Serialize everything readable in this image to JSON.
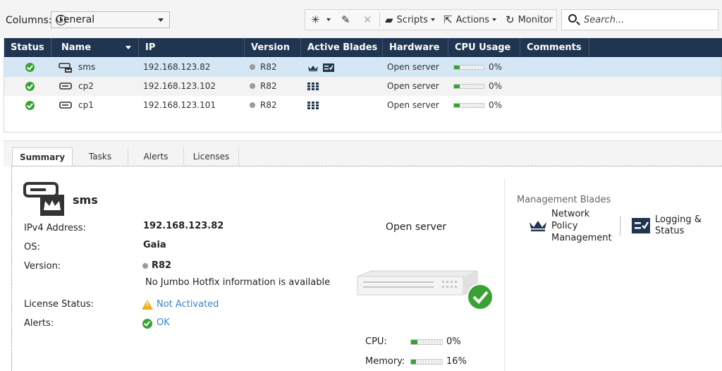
{
  "toolbar": {
    "columns_label": "Columns:",
    "columns_value": "General",
    "scripts_label": "Scripts",
    "actions_label": "Actions",
    "monitor_label": "Monitor",
    "search_placeholder": "Search..."
  },
  "grid": {
    "headers": {
      "status": "Status",
      "name": "Name",
      "ip": "IP",
      "version": "Version",
      "active_blades": "Active Blades",
      "hardware": "Hardware",
      "cpu_usage": "CPU Usage",
      "comments": "Comments"
    },
    "rows": [
      {
        "name": "sms",
        "ip": "192.168.123.82",
        "version": "R82",
        "hardware": "Open server",
        "cpu": "0%",
        "cpu_fraction": 0.2,
        "selected": true
      },
      {
        "name": "cp2",
        "ip": "192.168.123.102",
        "version": "R82",
        "hardware": "Open server",
        "cpu": "0%",
        "cpu_fraction": 0.2,
        "selected": false
      },
      {
        "name": "cp1",
        "ip": "192.168.123.101",
        "version": "R82",
        "hardware": "Open server",
        "cpu": "0%",
        "cpu_fraction": 0.2,
        "selected": false
      }
    ]
  },
  "tabs": [
    {
      "label": "Summary",
      "active": true
    },
    {
      "label": "Tasks",
      "active": false
    },
    {
      "label": "Alerts",
      "active": false
    },
    {
      "label": "Licenses",
      "active": false
    }
  ],
  "summary": {
    "name": "sms",
    "ipv4_label": "IPv4 Address:",
    "ipv4_value": "192.168.123.82",
    "os_label": "OS:",
    "os_value": "Gaia",
    "version_label": "Version:",
    "version_value": "R82",
    "hotfix_text": "No Jumbo Hotfix information is available",
    "license_label": "License Status:",
    "license_value": "Not Activated",
    "alerts_label": "Alerts:",
    "alerts_value": "OK",
    "hardware": "Open server",
    "cpu_label": "CPU:",
    "cpu_value": "0%",
    "cpu_fraction": 0.2,
    "memory_label": "Memory:",
    "memory_value": "16%",
    "memory_fraction": 0.16
  },
  "management": {
    "title": "Management Blades",
    "blades": [
      {
        "label": "Network Policy Management",
        "icon": "crown-icon"
      },
      {
        "label": "Logging & Status",
        "icon": "log-list-icon"
      }
    ]
  },
  "colors": {
    "header_bg": "#1f3550",
    "selected_row": "#d5e6f4",
    "ok_green": "#3aa235",
    "link_blue": "#3a85c8",
    "warning": "#f0b021"
  }
}
